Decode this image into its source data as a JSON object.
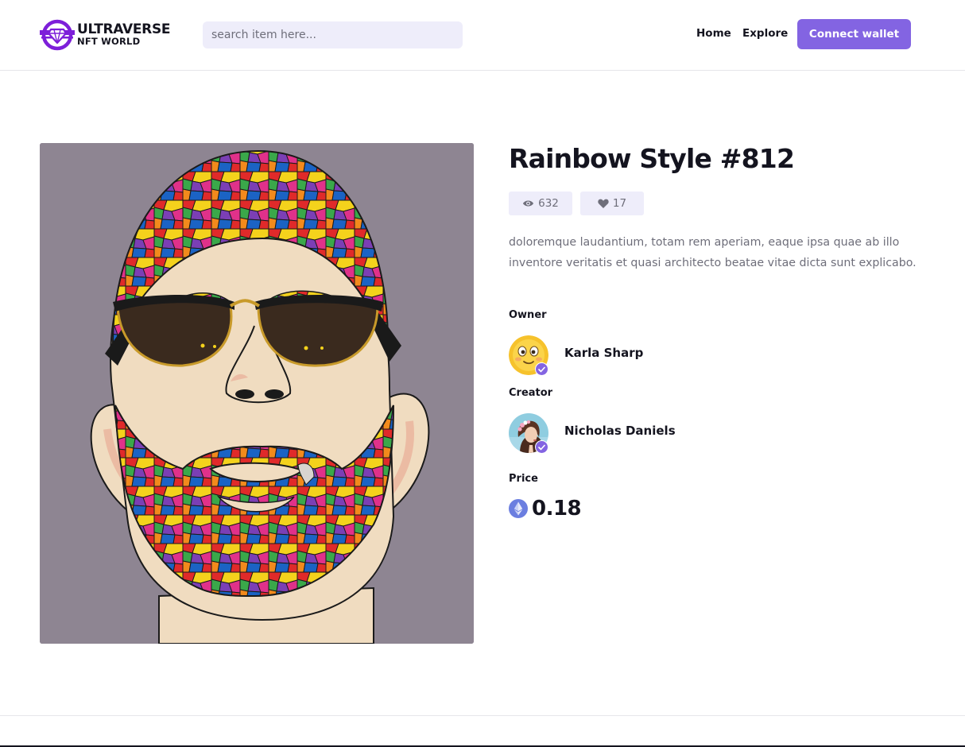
{
  "header": {
    "logo": {
      "line1": "ULTRAVERSE",
      "line2": "NFT WORLD"
    },
    "search": {
      "placeholder": "search item here..."
    },
    "nav": {
      "home": "Home",
      "explore": "Explore"
    },
    "connect_label": "Connect wallet"
  },
  "item": {
    "title": "Rainbow Style #812",
    "views": "632",
    "likes": "17",
    "description": "doloremque laudantium, totam rem aperiam, eaque ipsa quae ab illo inventore veritatis et quasi architecto beatae vitae dicta sunt explicabo.",
    "owner_label": "Owner",
    "owner_name": "Karla Sharp",
    "creator_label": "Creator",
    "creator_name": "Nicholas Daniels",
    "price_label": "Price",
    "price": "0.18"
  },
  "icons": {
    "views": "eye-icon",
    "likes": "heart-icon",
    "verified": "check-icon",
    "currency": "ethereum-icon"
  },
  "colors": {
    "accent": "#8364e2",
    "chip_background": "#eeedfa",
    "text": "#14141f",
    "muted": "#6e6e7a"
  }
}
